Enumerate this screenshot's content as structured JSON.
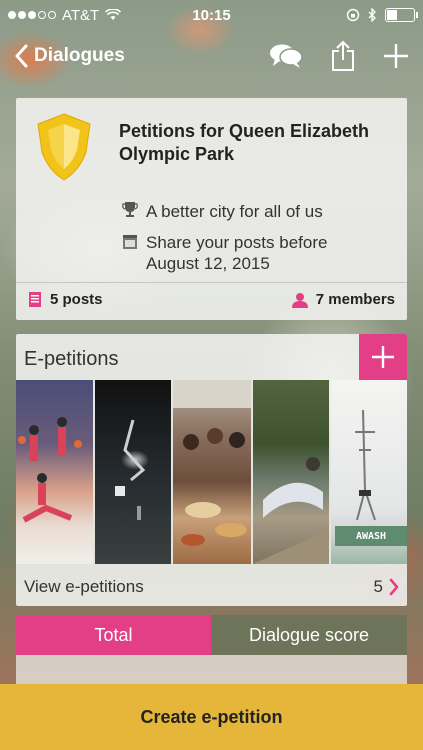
{
  "status_bar": {
    "carrier": "AT&T",
    "time": "10:15",
    "signal_bars_filled": 3,
    "signal_bars_total": 5,
    "battery_percent": 35
  },
  "nav": {
    "back_label": "Dialogues"
  },
  "group": {
    "title": "Petitions for Queen Elizabeth Olympic Park",
    "motto": "A better city for all of us",
    "deadline": "Share your posts before August 12, 2015",
    "posts": "5 posts",
    "members": "7 members"
  },
  "epetitions": {
    "title": "E-petitions",
    "view_label": "View e-petitions",
    "count": "5",
    "thumbnail_caption": "AWASH"
  },
  "tabs": {
    "total": "Total",
    "dialogue_score": "Dialogue score"
  },
  "cta": {
    "create_label": "Create e-petition"
  },
  "colors": {
    "accent": "#e23f86",
    "cta": "#e5b63a",
    "shield": "#f2c318"
  }
}
